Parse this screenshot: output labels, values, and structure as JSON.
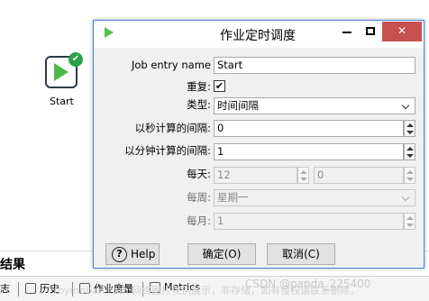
{
  "canvas": {
    "node_label": "Start",
    "result_title": "结果",
    "tabs": [
      {
        "label": "志"
      },
      {
        "label": "历史"
      },
      {
        "label": "作业度量"
      },
      {
        "label": "Metrics"
      }
    ],
    "watermark": "toymoban.com 网络图片仅供展示，非存储，如有侵权请联系删除。",
    "watermark2": "CSDN @panda_225400"
  },
  "dialog": {
    "title": "作业定时调度",
    "fields": {
      "job_entry_name": {
        "label": "Job entry name",
        "value": "Start"
      },
      "repeat": {
        "label": "重复:",
        "checked": true,
        "mark": "✔"
      },
      "type": {
        "label": "类型:",
        "value": "时间间隔"
      },
      "interval_seconds": {
        "label": "以秒计算的间隔:",
        "value": "0"
      },
      "interval_minutes": {
        "label": "以分钟计算的间隔:",
        "value": "1"
      },
      "daily": {
        "label": "每天:",
        "hour": "12",
        "minute": "0"
      },
      "weekly": {
        "label": "每周:",
        "value": "星期一"
      },
      "monthly": {
        "label": "每月:",
        "value": "1"
      }
    },
    "buttons": {
      "help": "Help",
      "ok": "确定(O)",
      "cancel": "取消(C)"
    }
  }
}
